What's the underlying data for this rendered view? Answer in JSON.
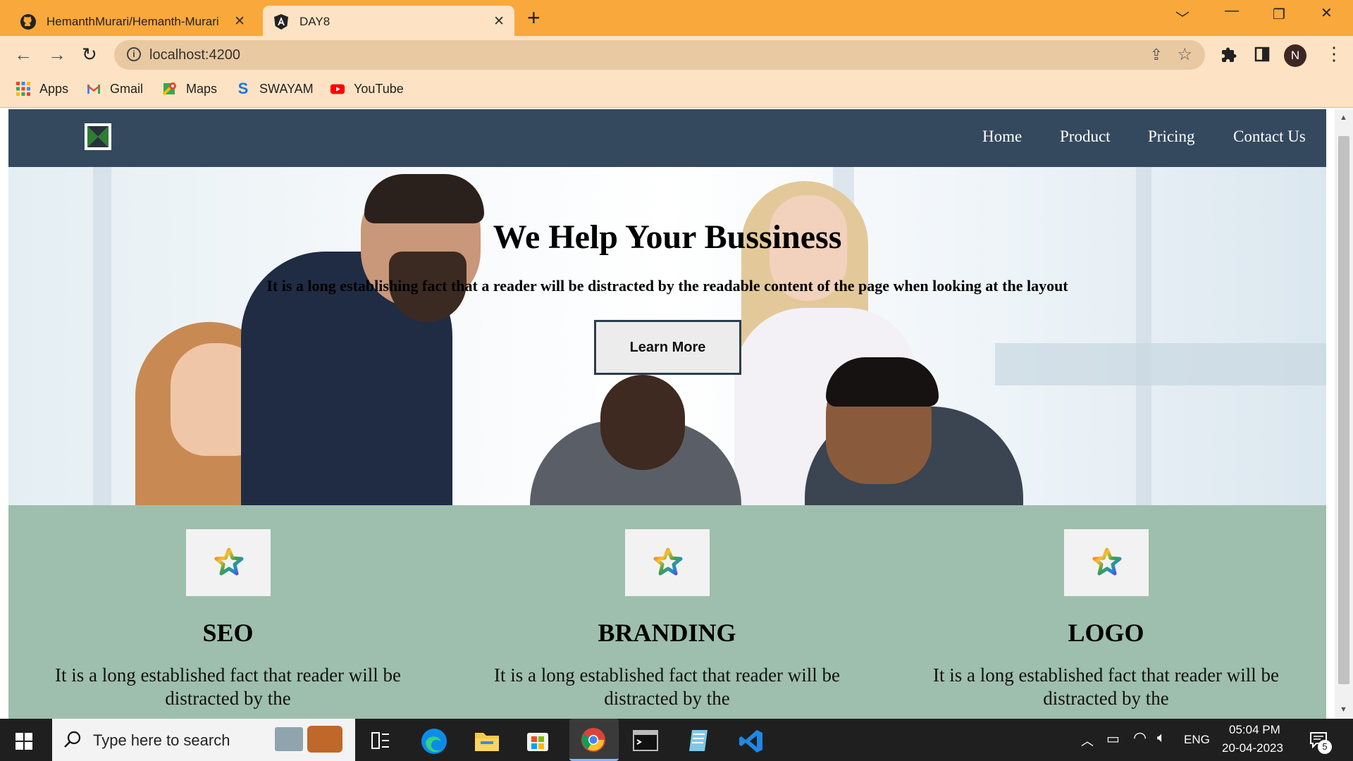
{
  "browser": {
    "tabs": [
      {
        "title": "HemanthMurari/Hemanth-Murari",
        "close": "✕"
      },
      {
        "title": "DAY8",
        "close": "✕"
      }
    ],
    "new_tab": "+",
    "url": "localhost:4200",
    "profile_initial": "N",
    "bookmarks": [
      {
        "label": "Apps",
        "icon": "apps-grid-icon"
      },
      {
        "label": "Gmail",
        "icon": "gmail-icon"
      },
      {
        "label": "Maps",
        "icon": "maps-icon"
      },
      {
        "label": "SWAYAM",
        "icon": "swayam-icon"
      },
      {
        "label": "YouTube",
        "icon": "youtube-icon"
      }
    ]
  },
  "site": {
    "nav": [
      "Home",
      "Product",
      "Pricing",
      "Contact Us"
    ],
    "hero": {
      "title": "We Help Your Bussiness",
      "text": "It is a long establishing fact that a reader will be distracted by the readable content of the page when looking at the layout",
      "button": "Learn More"
    },
    "cards": [
      {
        "title": "SEO",
        "text": "It is a long established fact that reader will be distracted by the"
      },
      {
        "title": "BRANDING",
        "text": "It is a long established fact that reader will be distracted by the"
      },
      {
        "title": "LOGO",
        "text": "It is a long established fact that reader will be distracted by the"
      }
    ],
    "colors": {
      "nav": "#34495e",
      "features_bg": "#9ebfad",
      "accent": "#f9a83c"
    }
  },
  "taskbar": {
    "search_placeholder": "Type here to search",
    "time": "05:04 PM",
    "date": "20-04-2023",
    "lang": "ENG",
    "notifications": "5"
  }
}
